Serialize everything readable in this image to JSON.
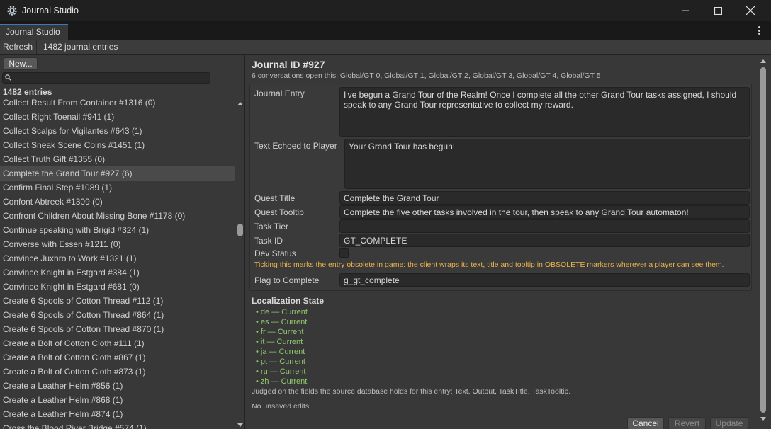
{
  "window": {
    "title": "Journal Studio"
  },
  "tab": {
    "label": "Journal Studio"
  },
  "toolbar": {
    "refresh_label": "Refresh",
    "count_label": "1482 journal entries"
  },
  "sidebar": {
    "new_button": "New...",
    "search_placeholder": "",
    "entries_header": "1482 entries",
    "items": [
      "Collect Result From Container #1316 (0)",
      "Collect Right Toenail #941 (1)",
      "Collect Scalps for Vigilantes #643 (1)",
      "Collect Sneak Scene Coins #1451 (1)",
      "Collect Truth Gift #1355 (0)",
      "Complete the Grand Tour #927 (6)",
      "Confirm Final Step #1089 (1)",
      "Confont Abtreek #1309 (0)",
      "Confront Children About Missing Bone #1178 (0)",
      "Continue speaking with Brigid #324 (1)",
      "Converse with Essen #1211 (0)",
      "Convince Juxhro to Work #1321 (1)",
      "Convince Knight in Estgard #384 (1)",
      "Convince Knight in Estgard #681 (0)",
      "Create 6 Spools of Cotton Thread #112 (1)",
      "Create 6 Spools of Cotton Thread #864 (1)",
      "Create 6 Spools of Cotton Thread #870 (1)",
      "Create a Bolt of Cotton Cloth #111 (1)",
      "Create a Bolt of Cotton Cloth #867 (1)",
      "Create a Bolt of Cotton Cloth #873 (1)",
      "Create a Leather Helm #856 (1)",
      "Create a Leather Helm #868 (1)",
      "Create a Leather Helm #874 (1)",
      "Cross the Blood River Bridge #574 (1)"
    ],
    "selected_index": 5
  },
  "detail": {
    "title": "Journal ID #927",
    "subtitle": "6 conversations open this: Global/GT 0, Global/GT 1, Global/GT 2, Global/GT 3, Global/GT 4, Global/GT 5",
    "labels": {
      "journal_entry": "Journal Entry",
      "text_echoed": "Text Echoed to Player",
      "quest_title": "Quest Title",
      "quest_tooltip": "Quest Tooltip",
      "task_tier": "Task Tier",
      "task_id": "Task ID",
      "dev_status": "Dev Status",
      "flag_to_complete": "Flag to Complete"
    },
    "values": {
      "journal_entry": "I've begun a Grand Tour of the Realm! Once I complete all the other Grand Tour tasks assigned, I should speak to any Grand Tour representative to collect my reward.",
      "text_echoed": "Your Grand Tour has begun!",
      "quest_title": "Complete the  Grand Tour",
      "quest_tooltip": "Complete the five other tasks involved in the tour, then speak to any Grand Tour automaton!",
      "task_tier": "",
      "task_id": "GT_COMPLETE",
      "dev_status_checked": false,
      "flag_to_complete": "g_gt_complete"
    },
    "dev_note": "Ticking this marks the entry obsolete in game: the client wraps its text, title and tooltip in OBSOLETE markers wherever a player can see them.",
    "localization": {
      "title": "Localization State",
      "items": [
        "• de — Current",
        "• es — Current",
        "• fr — Current",
        "• it — Current",
        "• ja — Current",
        "• pt — Current",
        "• ru — Current",
        "• zh — Current"
      ]
    },
    "judged_note": "Judged on the fields the source database holds for this entry: Text, Output, TaskTitle, TaskTooltip.",
    "unsaved_note": "No unsaved edits.",
    "buttons": {
      "cancel": "Cancel",
      "revert": "Revert",
      "update": "Update"
    }
  },
  "colors": {
    "accent": "#3a79bb",
    "warning_text": "#e9b44c",
    "status_current": "#8fc86b"
  }
}
